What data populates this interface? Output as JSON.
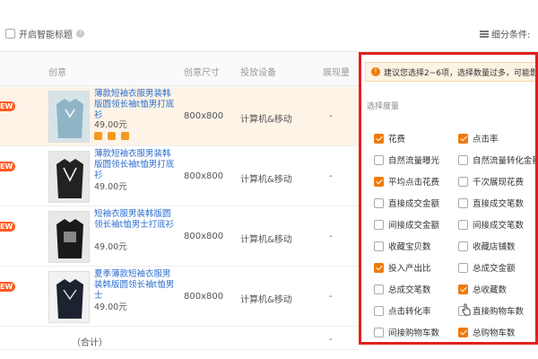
{
  "toolbar": {
    "smart_title_label": "开启智能标题",
    "filter_label": "细分条件:"
  },
  "table": {
    "headers": {
      "creative": "创意",
      "size": "创意尺寸",
      "device": "投放设备",
      "show": "展现量"
    },
    "rows": [
      {
        "badge": "EW",
        "title": "薄款短袖衣服男装韩版圆领长袖t恤男打底衫",
        "price": "49.00元",
        "size": "800x800",
        "device": "计算机&移动",
        "show": "-"
      },
      {
        "badge": "EW",
        "title": "薄款短袖衣服男装韩版圆领长袖t恤男打底衫",
        "price": "49.00元",
        "size": "800x800",
        "device": "计算机&移动",
        "show": "-"
      },
      {
        "badge": "EW",
        "title": "短袖衣服男装韩版圆领长袖t恤男士打底衫",
        "price": "49.00元",
        "size": "800x800",
        "device": "计算机&移动",
        "show": "-"
      },
      {
        "badge": "EW",
        "title": "夏季薄款短袖衣服男装韩版圆领长袖t恤男士",
        "price": "49.00元",
        "size": "800x800",
        "device": "计算机&移动",
        "show": "-"
      }
    ],
    "total_label": "（合计）",
    "total_show": "-"
  },
  "panel": {
    "tip": "建议您选择2~6项，选择数量过多，可能影",
    "select_label": "选择度量",
    "metrics_left": [
      {
        "label": "花费",
        "checked": true
      },
      {
        "label": "自然流量曝光",
        "checked": false
      },
      {
        "label": "平均点击花费",
        "checked": true
      },
      {
        "label": "直接成交金额",
        "checked": false
      },
      {
        "label": "间接成交金额",
        "checked": false
      },
      {
        "label": "收藏宝贝数",
        "checked": false
      },
      {
        "label": "投入产出比",
        "checked": true
      },
      {
        "label": "总成交笔数",
        "checked": false
      },
      {
        "label": "点击转化率",
        "checked": false
      },
      {
        "label": "间接购物车数",
        "checked": false
      }
    ],
    "metrics_right": [
      {
        "label": "点击率",
        "checked": true
      },
      {
        "label": "自然流量转化金额",
        "checked": false
      },
      {
        "label": "千次展现花费",
        "checked": false
      },
      {
        "label": "直接成交笔数",
        "checked": false
      },
      {
        "label": "间接成交笔数",
        "checked": false
      },
      {
        "label": "收藏店铺数",
        "checked": false
      },
      {
        "label": "总成交金额",
        "checked": false
      },
      {
        "label": "总收藏数",
        "checked": true
      },
      {
        "label": "直接购物车数",
        "checked": false
      },
      {
        "label": "总购物车数",
        "checked": true
      }
    ]
  },
  "colors": {
    "accent": "#f07a0a",
    "highlight_border": "#e0211d",
    "link": "#2b6dce",
    "new_badge": "#ff5a1f"
  },
  "icons": [
    "help-icon",
    "filter-icon",
    "warning-icon",
    "edit-icon",
    "delete-icon",
    "copy-icon",
    "hand-cursor-icon"
  ]
}
